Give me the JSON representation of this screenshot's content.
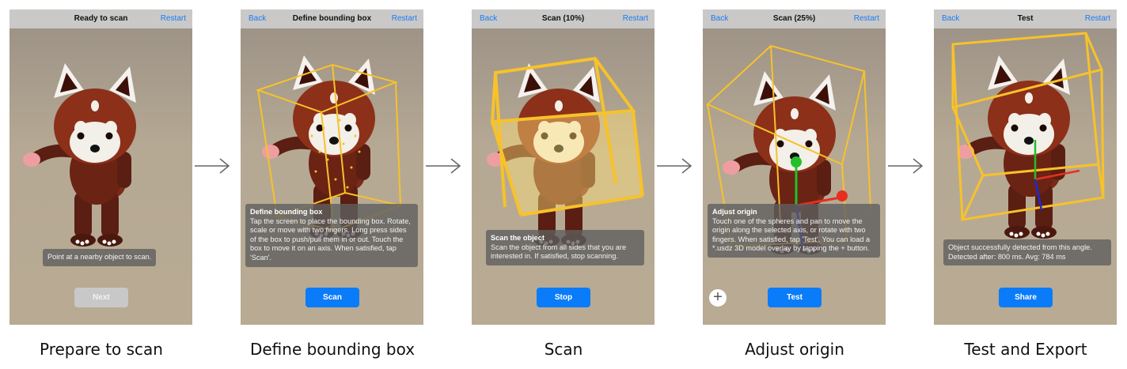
{
  "colors": {
    "accent": "#0b7cf9",
    "box_outline": "#f7c22a",
    "disabled_button": "#c8c8c8",
    "axis_x": "#e53020",
    "axis_y": "#22c02a",
    "axis_z": "#1b2ad6"
  },
  "steps": [
    {
      "caption": "Prepare to scan",
      "nav": {
        "title": "Ready to scan",
        "back": "",
        "restart": "Restart"
      },
      "message": {
        "title": "",
        "body": "Point at a nearby object to scan."
      },
      "button": "Next"
    },
    {
      "caption": "Define bounding box",
      "nav": {
        "title": "Define bounding box",
        "back": "Back",
        "restart": "Restart"
      },
      "message": {
        "title": "Define bounding box",
        "body": "Tap the screen to place the bounding box. Rotate, scale or move with two fingers. Long press sides of the box to push/pull them in or out. Touch the box to move it on an axis. When satisfied, tap 'Scan'."
      },
      "button": "Scan"
    },
    {
      "caption": "Scan",
      "nav": {
        "title": "Scan (10%)",
        "back": "Back",
        "restart": "Restart"
      },
      "message": {
        "title": "Scan the object",
        "body": "Scan the object from all sides that you are interested in. If satisfied, stop scanning."
      },
      "button": "Stop"
    },
    {
      "caption": "Adjust origin",
      "nav": {
        "title": "Scan (25%)",
        "back": "Back",
        "restart": "Restart"
      },
      "message": {
        "title": "Adjust origin",
        "body": "Touch one of the spheres and pan to move the origin along the selected axis, or rotate with two fingers. When satisfied, tap 'Test'. You can load a *.usdz 3D model overlay by tapping the + button."
      },
      "button": "Test",
      "plus": "+"
    },
    {
      "caption": "Test and Export",
      "nav": {
        "title": "Test",
        "back": "Back",
        "restart": "Restart"
      },
      "message": {
        "title": "",
        "body": "Object successfully detected from this angle. Detected after: 800 ms. Avg: 784 ms"
      },
      "button": "Share"
    }
  ]
}
